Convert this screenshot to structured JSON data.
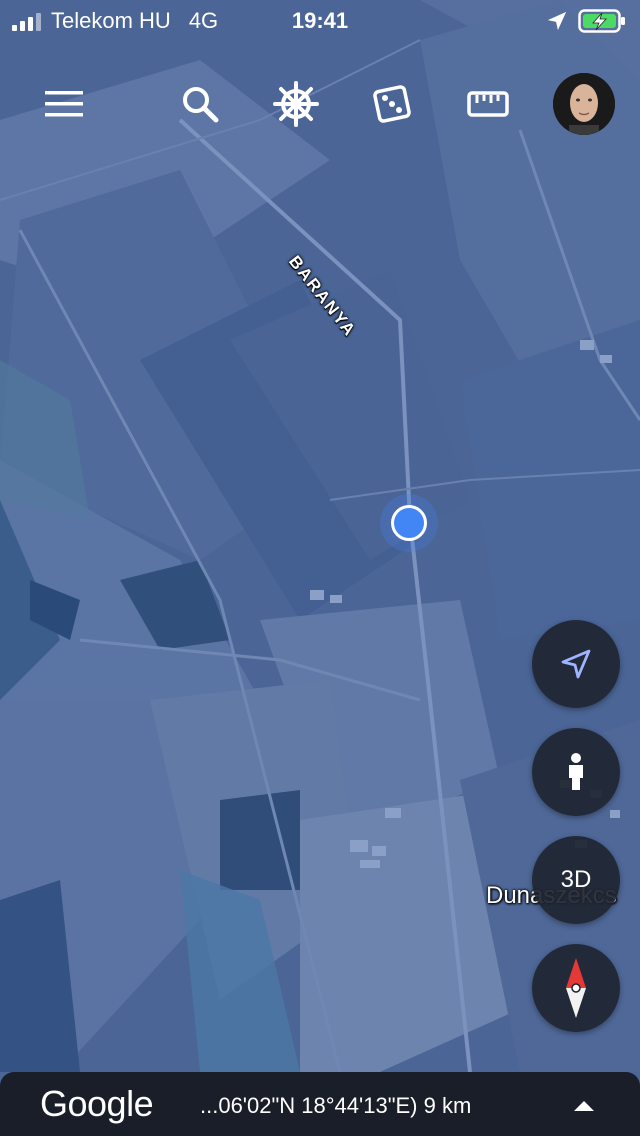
{
  "status_bar": {
    "carrier": "Telekom HU",
    "network": "4G",
    "time": "19:41",
    "battery_color": "#4cd964"
  },
  "toolbar": {
    "icons": [
      "menu-icon",
      "search-icon",
      "voyager-icon",
      "dice-icon",
      "ruler-icon"
    ],
    "account": "avatar"
  },
  "map": {
    "region_label": "BARANYA",
    "town_label": "Dunaszekcs",
    "location_color": "#4285f4"
  },
  "controls": {
    "three_d_label": "3D",
    "compass_colors": [
      "#e53935",
      "#ffffff"
    ]
  },
  "bottom_bar": {
    "brand": "Google",
    "coordinates": "...06'02\"N 18°44'13\"E) 9 km"
  }
}
